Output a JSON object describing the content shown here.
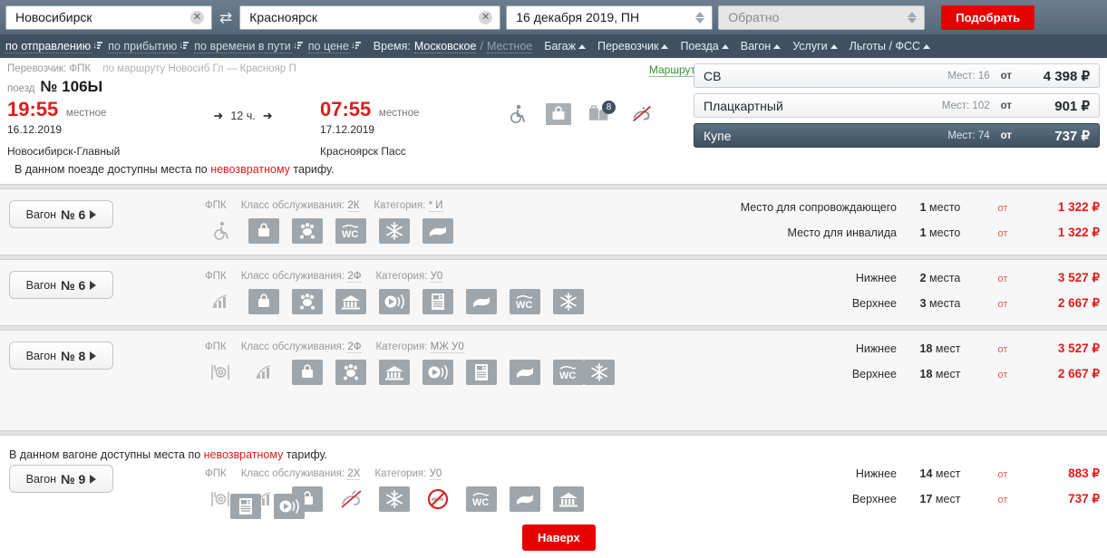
{
  "search": {
    "from_value": "Новосибирск",
    "to_value": "Красноярск",
    "date_value": "16 декабря 2019, ПН",
    "back_placeholder": "Обратно",
    "back_value": "",
    "submit_label": "Подобрать",
    "swap_icon": "swap-arrows-icon",
    "clear_icon": "clear-x-icon"
  },
  "filters": {
    "sorts": [
      {
        "label": "по отправлению",
        "active": true
      },
      {
        "label": "по прибытию",
        "active": false
      },
      {
        "label": "по времени в пути",
        "active": false
      },
      {
        "label": "по цене",
        "active": false
      }
    ],
    "time_label": "Время:",
    "time_moscow": "Московское",
    "time_slash": "/",
    "time_local": "Местное",
    "menus": [
      {
        "label": "Багаж"
      },
      {
        "label": "Перевозчик"
      },
      {
        "label": "Поезда"
      },
      {
        "label": "Вагон"
      },
      {
        "label": "Услуги"
      },
      {
        "label": "Льготы / ФСС"
      }
    ]
  },
  "train": {
    "carrier_label": "Перевозчик: ФПК",
    "route_sub": "по маршруту Новосиб Гл — Краснояр П",
    "route_link": "Маршрут",
    "train_word": "поезд",
    "train_number": "№ 106Ы",
    "depart": {
      "time": "19:55",
      "time_kind": "местное",
      "date": "16.12.2019",
      "station": "Новосибирск-Главный"
    },
    "duration": "12 ч.",
    "arrive": {
      "time": "07:55",
      "time_kind": "местное",
      "date": "17.12.2019",
      "station": "Красноярск Пасс"
    },
    "header_icons": [
      {
        "name": "wheelchair-icon",
        "badge": ""
      },
      {
        "name": "bag-icon",
        "badge": ""
      },
      {
        "name": "luggage-icon",
        "badge": "8"
      },
      {
        "name": "no-pets-icon",
        "badge": ""
      }
    ],
    "notice_prefix": "В данном поезде доступны места по ",
    "notice_red": "невозвратному",
    "notice_suffix": " тарифу."
  },
  "classes": [
    {
      "name": "СВ",
      "seats_label": "Мест: 16",
      "ot": "от",
      "price": "4 398 ₽",
      "selected": false
    },
    {
      "name": "Плацкартный",
      "seats_label": "Мест: 102",
      "ot": "от",
      "price": "901 ₽",
      "selected": false
    },
    {
      "name": "Купе",
      "seats_label": "Мест: 74",
      "ot": "от",
      "price": "737 ₽",
      "selected": true
    }
  ],
  "wagons": [
    {
      "button_label": "Вагон",
      "button_number": "№ 6",
      "carrier": "ФПК",
      "service_class_label": "Класс обслуживания:",
      "service_class": "2К",
      "category_label": "Категория:",
      "category": "* И",
      "notice": null,
      "icons": [
        {
          "name": "wheelchair-icon",
          "boxed": false
        },
        {
          "name": "bag-icon",
          "boxed": true
        },
        {
          "name": "pets-icon",
          "boxed": true
        },
        {
          "name": "wc-icon",
          "boxed": true
        },
        {
          "name": "air-conditioning-icon",
          "boxed": true
        },
        {
          "name": "bedding-icon",
          "boxed": true
        }
      ],
      "seats": [
        {
          "name": "Место для сопровождающего",
          "count_num": "1",
          "count_word": "место",
          "ot": "от",
          "price": "1 322 ₽"
        },
        {
          "name": "Место для инвалида",
          "count_num": "1",
          "count_word": "место",
          "ot": "от",
          "price": "1 322 ₽"
        }
      ]
    },
    {
      "button_label": "Вагон",
      "button_number": "№ 6",
      "carrier": "ФПК",
      "service_class_label": "Класс обслуживания:",
      "service_class": "2Ф",
      "category_label": "Категория:",
      "category": "У0",
      "notice": null,
      "icons": [
        {
          "name": "wifi-signal-icon",
          "boxed": false
        },
        {
          "name": "bag-icon",
          "boxed": true
        },
        {
          "name": "pets-icon",
          "boxed": true
        },
        {
          "name": "museum-ticket-icon",
          "boxed": true
        },
        {
          "name": "multimedia-icon",
          "boxed": true
        },
        {
          "name": "press-icon",
          "boxed": true
        },
        {
          "name": "bedding-icon",
          "boxed": true
        },
        {
          "name": "wc-icon",
          "boxed": true
        },
        {
          "name": "air-conditioning-icon",
          "boxed": true
        }
      ],
      "seats": [
        {
          "name": "Нижнее",
          "count_num": "2",
          "count_word": "места",
          "ot": "от",
          "price": "3 527 ₽"
        },
        {
          "name": "Верхнее",
          "count_num": "3",
          "count_word": "места",
          "ot": "от",
          "price": "2 667 ₽"
        }
      ]
    },
    {
      "button_label": "Вагон",
      "button_number": "№ 8",
      "carrier": "ФПК",
      "service_class_label": "Класс обслуживания:",
      "service_class": "2Ф",
      "category_label": "Категория:",
      "category": "МЖ У0",
      "notice": null,
      "icons": [
        {
          "name": "meal-icon",
          "boxed": false
        },
        {
          "name": "wifi-signal-icon",
          "boxed": false
        },
        {
          "name": "bag-icon",
          "boxed": true
        },
        {
          "name": "pets-icon",
          "boxed": true
        },
        {
          "name": "museum-ticket-icon",
          "boxed": true
        },
        {
          "name": "multimedia-icon",
          "boxed": true
        },
        {
          "name": "press-icon",
          "boxed": true
        },
        {
          "name": "bedding-icon",
          "boxed": true
        },
        {
          "name": "wc-icon",
          "boxed": true
        },
        {
          "name": "air-conditioning-icon",
          "boxed": true
        }
      ],
      "seats": [
        {
          "name": "Нижнее",
          "count_num": "18",
          "count_word": "мест",
          "ot": "от",
          "price": "3 527 ₽"
        },
        {
          "name": "Верхнее",
          "count_num": "18",
          "count_word": "мест",
          "ot": "от",
          "price": "2 667 ₽"
        }
      ]
    },
    {
      "button_label": "Вагон",
      "button_number": "№ 9",
      "carrier": "ФПК",
      "service_class_label": "Класс обслуживания:",
      "service_class": "2Х",
      "category_label": "Категория:",
      "category": "У0",
      "notice": {
        "prefix": "В данном вагоне доступны места по ",
        "red": "невозвратному",
        "suffix": " тарифу."
      },
      "icons": [
        {
          "name": "meal-icon",
          "boxed": false
        },
        {
          "name": "wifi-signal-icon",
          "boxed": false
        },
        {
          "name": "bag-icon",
          "boxed": true
        },
        {
          "name": "no-pets-icon",
          "boxed": false
        },
        {
          "name": "air-conditioning-icon",
          "boxed": true
        },
        {
          "name": "no-smoking-icon",
          "boxed": false
        },
        {
          "name": "wc-icon",
          "boxed": true
        },
        {
          "name": "bedding-icon",
          "boxed": true
        },
        {
          "name": "museum-ticket-icon",
          "boxed": true
        },
        {
          "name": "press-icon",
          "boxed": true
        },
        {
          "name": "multimedia-icon",
          "boxed": true
        }
      ],
      "seats": [
        {
          "name": "Нижнее",
          "count_num": "14",
          "count_word": "мест",
          "ot": "от",
          "price": "883 ₽"
        },
        {
          "name": "Верхнее",
          "count_num": "17",
          "count_word": "мест",
          "ot": "от",
          "price": "737 ₽"
        }
      ]
    }
  ],
  "footer": {
    "top_button": "Наверх"
  },
  "colors": {
    "accent_red": "#e60000",
    "price_red": "#e11b1b",
    "header_blue": "#55687a",
    "filter_blue": "#3f5161",
    "link_green": "#3a8f3a"
  }
}
